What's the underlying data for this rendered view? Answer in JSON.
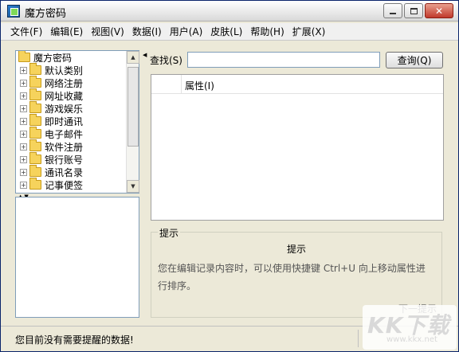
{
  "window": {
    "title": "魔方密码"
  },
  "menu": [
    "文件(F)",
    "编辑(E)",
    "视图(V)",
    "数据(I)",
    "用户(A)",
    "皮肤(L)",
    "帮助(H)",
    "扩展(X)"
  ],
  "tree": {
    "root": "魔方密码",
    "items": [
      "默认类别",
      "网络注册",
      "网址收藏",
      "游戏娱乐",
      "即时通讯",
      "电子邮件",
      "软件注册",
      "银行账号",
      "通讯名录",
      "记事便签"
    ]
  },
  "search": {
    "label": "查找(S)",
    "value": "",
    "button": "查询(Q)"
  },
  "table": {
    "columns": [
      "",
      "属性(I)"
    ]
  },
  "hint": {
    "legend": "提示",
    "title": "提示",
    "text": "您在编辑记录内容时，可以使用快捷键 Ctrl+U 向上移动属性进行排序。",
    "footer": "下一提示"
  },
  "status": {
    "message": "您目前没有需要提醒的数据!"
  },
  "watermark": {
    "logo": "KK下载",
    "url": "www.kkx.net"
  },
  "colors": {
    "tree_border": "#7f9db9",
    "folder": "#f6d35c",
    "face": "#ece9d8"
  }
}
